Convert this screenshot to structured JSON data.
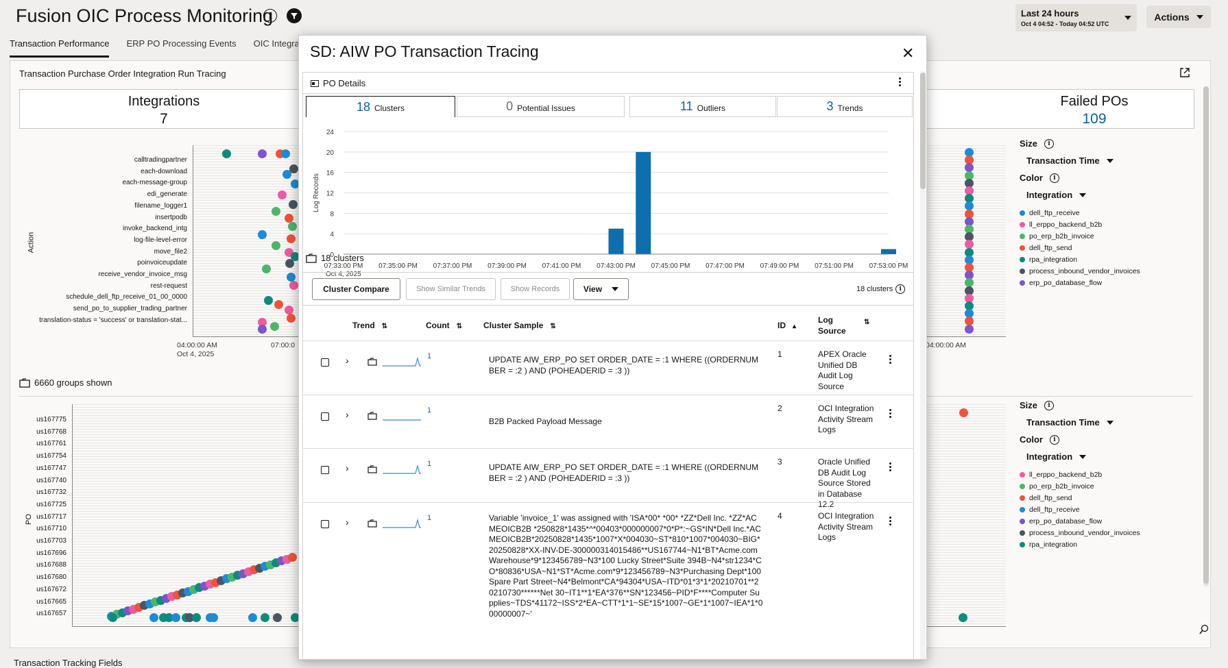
{
  "header": {
    "title": "Fusion OIC Process Monitoring",
    "time_range": "Last 24 hours",
    "time_detail": "Oct 4 04:52 - Today 04:52 UTC",
    "actions_label": "Actions"
  },
  "tabs": [
    "Transaction Performance",
    "ERP PO Processing Events",
    "OIC Integratio"
  ],
  "panel": {
    "title": "Transaction Purchase Order Integration Run Tracing",
    "kpi_left": {
      "label": "Integrations",
      "value": "7"
    },
    "kpi_right": {
      "label": "Failed POs",
      "value": "109"
    },
    "groups_shown": "6660 groups shown",
    "footer_text": "Transaction Tracking Fields",
    "top_chart": {
      "y_axis_label": "Action",
      "x_ticks": [
        "04:00:00 AM",
        "07:00:0"
      ],
      "x_date": "Oct 4, 2025",
      "right_x_tick": "04:00:00 AM",
      "actions": [
        "calltradingpartner",
        "each-download",
        "each-message-group",
        "edi_generate",
        "filename_logger1",
        "insertpodb",
        "invoke_backend_intg",
        "log-file-level-error",
        "move_file2",
        "poinvoiceupdate",
        "receive_vendor_invoice_msg",
        "rest-request",
        "schedule_dell_ftp_receive_01_00_0000",
        "send_po_to_supplier_trading_partner",
        "translation-status = 'success' or translation-stat..."
      ]
    },
    "bottom_chart": {
      "y_axis_label": "PO",
      "pos": [
        "us167775",
        "us167768",
        "us167761",
        "us167754",
        "us167747",
        "us167740",
        "us167732",
        "us167725",
        "us167717",
        "us167710",
        "us167703",
        "us167696",
        "us167688",
        "us167680",
        "us167672",
        "us167665",
        "us167657"
      ]
    },
    "side_top": {
      "size_label": "Size",
      "size_value": "Transaction Time",
      "color_label": "Color",
      "color_value": "Integration",
      "legend": [
        {
          "name": "dell_ftp_receive",
          "color": "#1d8bd6"
        },
        {
          "name": "ll_erppo_backend_b2b",
          "color": "#ef5ba1"
        },
        {
          "name": "po_erp_b2b_invoice",
          "color": "#4db56a"
        },
        {
          "name": "dell_ftp_send",
          "color": "#f0533b"
        },
        {
          "name": "rpa_integration",
          "color": "#0f8b7c"
        },
        {
          "name": "process_inbound_vendor_invoices",
          "color": "#4b5563"
        },
        {
          "name": "erp_po_database_flow",
          "color": "#7b57c9"
        }
      ]
    },
    "side_bottom": {
      "size_label": "Size",
      "size_value": "Transaction Time",
      "color_label": "Color",
      "color_value": "Integration",
      "legend": [
        {
          "name": "ll_erppo_backend_b2b",
          "color": "#ef5ba1"
        },
        {
          "name": "po_erp_b2b_invoice",
          "color": "#4db56a"
        },
        {
          "name": "dell_ftp_send",
          "color": "#f0533b"
        },
        {
          "name": "dell_ftp_receive",
          "color": "#1d8bd6"
        },
        {
          "name": "erp_po_database_flow",
          "color": "#7b57c9"
        },
        {
          "name": "process_inbound_vendor_invoices",
          "color": "#4b5563"
        },
        {
          "name": "rpa_integration",
          "color": "#0f8b7c"
        }
      ]
    }
  },
  "modal": {
    "title": "SD: AIW PO Transaction Tracing",
    "section_title": "PO Details",
    "summary_tabs": [
      {
        "count": "18",
        "label": "Clusters"
      },
      {
        "count": "0",
        "label": "Potential Issues"
      },
      {
        "count": "11",
        "label": "Outliers"
      },
      {
        "count": "3",
        "label": "Trends"
      }
    ],
    "clusters_caption": "18 clusters",
    "buttons": {
      "compare": "Cluster Compare",
      "similar": "Show Similar Trends",
      "records": "Show Records",
      "view": "View",
      "count_label": "18 clusters"
    },
    "table_headers": {
      "trend": "Trend",
      "count": "Count",
      "sample": "Cluster Sample",
      "id": "ID",
      "log_source": "Log Source"
    },
    "rows": [
      {
        "count": "1",
        "sample": "UPDATE AIW_ERP_PO SET ORDER_DATE = :1  WHERE ((ORDERNUMBER = :2 ) AND (POHEADERID = :3 ))",
        "id": "1",
        "log_source": "APEX Oracle Unified DB Audit Log Source"
      },
      {
        "count": "1",
        "sample": "B2B Packed Payload Message",
        "id": "2",
        "log_source": "OCI Integration Activity Stream Logs"
      },
      {
        "count": "1",
        "sample": "UPDATE AIW_ERP_PO SET ORDER_DATE = :1  WHERE ((ORDERNUMBER = :2 ) AND (POHEADERID = :3 ))",
        "id": "3",
        "log_source": "Oracle Unified DB Audit Log Source Stored in Database 12.2"
      },
      {
        "count": "1",
        "sample": "Variable 'invoice_1' was assigned with 'ISA*00*          *00*          *ZZ*Dell Inc.      *ZZ*ACMEOICB2B      *250828*1435*^*00403*000000007*0*P*:~GS*IN*Dell Inc.*ACMEOICB2B*20250828*1435*1007*X*004030~ST*810*1007*004030~BIG*20250828*XX-INV-DE-300000314015486**US167744~N1*BT*Acme.com Warehouse*9*123456789~N3*100 Lucky Street*Suite 394B~N4*str1234*CO*80836*USA~N1*ST*Acme.com*9*123456789~N3*Purchasing Dept*100 Spare Part Street~N4*Belmont*CA*94304*USA~ITD*01*3*1*20210701**20210730******Net 30~IT1**1*EA*376**SN*123456~PID*F****Computer Supplies~TDS*41172~ISS*2*EA~CTT*1*1~SE*15*1007~GE*1*1007~IEA*1*000000007~'",
        "id": "4",
        "log_source": "OCI Integration Activity Stream Logs"
      }
    ]
  },
  "chart_data": {
    "type": "bar",
    "title": "",
    "xlabel": "",
    "ylabel": "Log Records",
    "x_ticks": [
      "07:33:00 PM",
      "07:35:00 PM",
      "07:37:00 PM",
      "07:39:00 PM",
      "07:41:00 PM",
      "07:43:00 PM",
      "07:45:00 PM",
      "07:47:00 PM",
      "07:49:00 PM",
      "07:51:00 PM",
      "07:53:00 PM"
    ],
    "x_date": "Oct 4, 2025",
    "y_ticks": [
      0,
      4,
      8,
      12,
      16,
      20,
      24
    ],
    "ylim": [
      0,
      24
    ],
    "bars": [
      {
        "x": "07:43:00 PM",
        "value": 5
      },
      {
        "x": "07:44:00 PM",
        "value": 20
      },
      {
        "x": "07:53:00 PM",
        "value": 1
      }
    ],
    "color": "#0d6fad",
    "grid": true
  }
}
